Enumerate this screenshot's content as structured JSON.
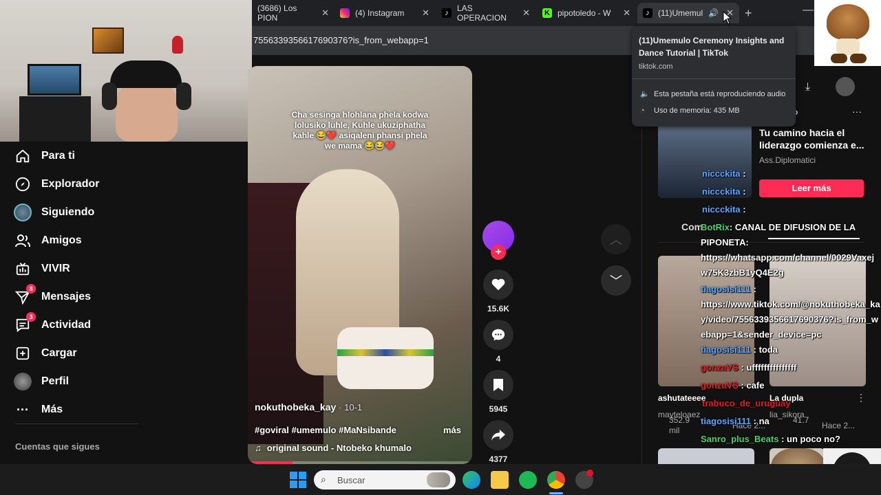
{
  "browser": {
    "tabs": [
      {
        "title": "(3686) Los PION",
        "icon": "youtube-icon"
      },
      {
        "title": "(4) Instagram",
        "icon": "instagram-icon"
      },
      {
        "title": "LAS OPERACION",
        "icon": "tiktok-icon"
      },
      {
        "title": "pipotoledo - W",
        "icon": "kick-icon"
      },
      {
        "title": "(11)Umemul",
        "icon": "tiktok-icon"
      }
    ],
    "url": "7556339356617690376?is_from_webapp=1",
    "tooltip": {
      "title": "(11)Umemulo Ceremony Insights and Dance Tutorial | TikTok",
      "domain": "tiktok.com",
      "audio": "Esta pestaña está reproduciendo audio",
      "memory": "Uso de memoria: 435 MB"
    }
  },
  "sidebar": {
    "items": [
      {
        "label": "Para ti",
        "icon": "home-icon"
      },
      {
        "label": "Explorador",
        "icon": "compass-icon"
      },
      {
        "label": "Siguiendo",
        "icon": "following-avatar-icon"
      },
      {
        "label": "Amigos",
        "icon": "friends-icon"
      },
      {
        "label": "VIVIR",
        "icon": "live-icon"
      },
      {
        "label": "Mensajes",
        "icon": "messages-icon",
        "badge": "8"
      },
      {
        "label": "Actividad",
        "icon": "activity-icon",
        "badge": "3"
      },
      {
        "label": "Cargar",
        "icon": "upload-icon"
      },
      {
        "label": "Perfil",
        "icon": "profile-icon"
      },
      {
        "label": "Más",
        "icon": "more-icon"
      }
    ],
    "following_heading": "Cuentas que sigues"
  },
  "video": {
    "caption_overlay": "Cha sesinga hlohlana phela kodwa lolusiko luhle, Kuhle ukuziphatha kahle 😂❤️ asiqaleni phansi phela we mama 😂😂❤️",
    "author": "nokuthobeka_kay",
    "date": "· 10-1",
    "hashtags": "#goviral #umemulo #MaNsibande",
    "more": "más",
    "sound": "original sound - Ntobeko khumalo",
    "progress": 0.2
  },
  "actions": {
    "likes": "15.6K",
    "comments": "4",
    "saves": "5945",
    "shares": "4377"
  },
  "right_panel": {
    "ad": {
      "title": "Tu camino hacia el liderazgo comienza e...",
      "sponsor": "Ass.Diplomatici",
      "cta": "Leer más",
      "partial": "o"
    },
    "comments_tab": "Com",
    "card1": {
      "user": "ashutateeee",
      "views": "352.9 mil",
      "date": "Hace 2..."
    },
    "card2": {
      "user": "mayteloпez",
      "title": "La dupla",
      "sub": "lia_sikora",
      "views": "41.7",
      "date": "Hace 2..."
    },
    "card1_user2": "mayteloaez"
  },
  "chat": [
    {
      "user": "niccckita",
      "text": ""
    },
    {
      "user": "niccckita",
      "text": ""
    },
    {
      "user": "niccckita",
      "text": ""
    },
    {
      "user": "BotRix",
      "text": ": CANAL DE DIFUSION DE LA PIPONETA:"
    },
    {
      "user": "",
      "text": "https://whatsapp.com/channel/0029Vaxejw75K3zbB1yQ4E2g"
    },
    {
      "user": "tiagosisi111",
      "text": ":"
    },
    {
      "user": "",
      "text": "https://www.tiktok.com/@nokuthobeka_kay/video/7556339356617690376?is_from_webapp=1&sender_device=pc"
    },
    {
      "user": "tiagosisi111",
      "text": ": toda"
    },
    {
      "user": "gonzaVS",
      "text": ": ufffffffffffffff"
    },
    {
      "user": "gonzaVS",
      "text": ": cafe"
    },
    {
      "user": "trabuco_de_uruguay",
      "text": ": "
    },
    {
      "user": "tiagosisi111",
      "text": ": na"
    },
    {
      "user": "Sanro_plus_Beats",
      "text": ": un poco no?"
    }
  ],
  "taskbar": {
    "search_placeholder": "Buscar"
  },
  "colors": {
    "accent": "#fe2c55",
    "chat_blue": "#5aa7ff",
    "chat_red": "#d8222a",
    "chat_green": "#4fd06f"
  }
}
